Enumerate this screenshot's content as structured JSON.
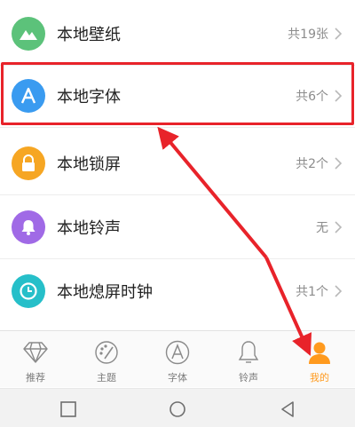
{
  "list": {
    "items": [
      {
        "label": "本地壁纸",
        "count": "共19张",
        "icon": "mountain-icon",
        "color": "#5cc27a"
      },
      {
        "label": "本地字体",
        "count": "共6个",
        "icon": "font-a-icon",
        "color": "#3a9bf0"
      },
      {
        "label": "本地锁屏",
        "count": "共2个",
        "icon": "lock-icon",
        "color": "#f6a623"
      },
      {
        "label": "本地铃声",
        "count": "无",
        "icon": "bell-icon",
        "color": "#a06ae6"
      },
      {
        "label": "本地熄屏时钟",
        "count": "共1个",
        "icon": "clock-icon",
        "color": "#26bfc9"
      }
    ]
  },
  "tabbar": {
    "tabs": [
      {
        "label": "推荐",
        "icon": "diamond-icon"
      },
      {
        "label": "主题",
        "icon": "palette-icon"
      },
      {
        "label": "字体",
        "icon": "font-a-outline-icon"
      },
      {
        "label": "铃声",
        "icon": "bell-outline-icon"
      },
      {
        "label": "我的",
        "icon": "person-icon",
        "active": true
      }
    ]
  },
  "colors": {
    "highlight": "#e8232a",
    "accent": "#ff9a1e"
  }
}
